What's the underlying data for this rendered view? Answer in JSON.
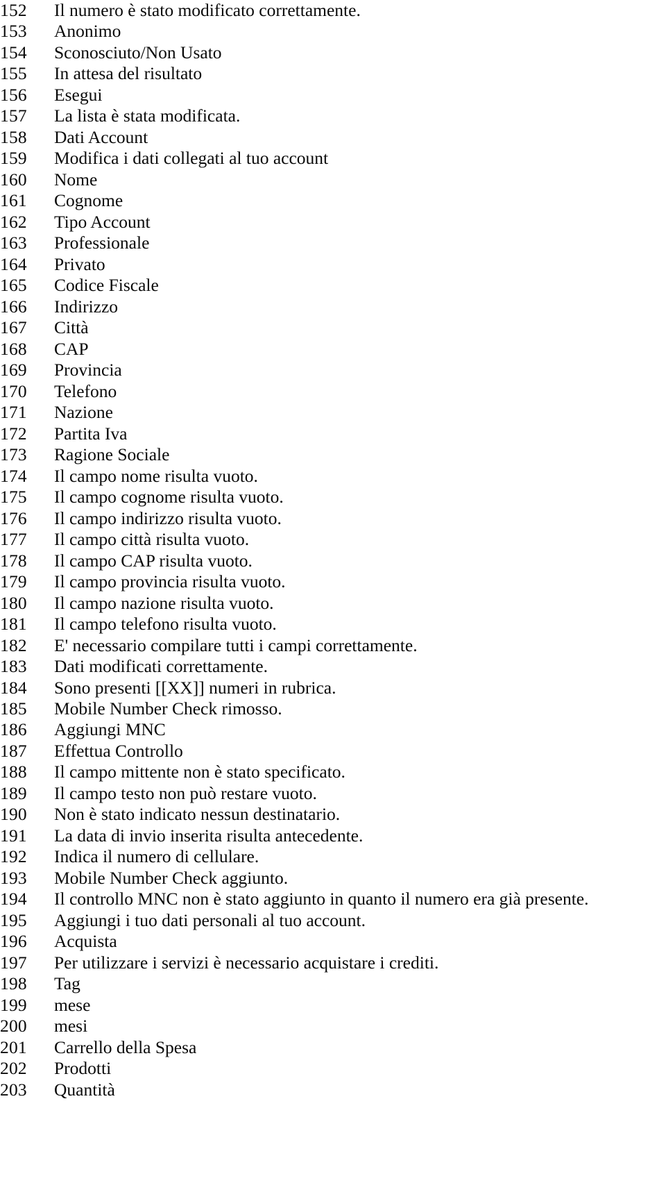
{
  "document": {
    "type": "numbered-string-list",
    "language": "Italian",
    "first_line_number": 152,
    "last_line_number": 203,
    "total_rows": 52,
    "text_color": "#0a0a0a",
    "background_color": "#ffffff"
  },
  "rows": [
    {
      "number": "152",
      "text": "Il numero è stato modificato correttamente."
    },
    {
      "number": "153",
      "text": "Anonimo"
    },
    {
      "number": "154",
      "text": "Sconosciuto/Non Usato"
    },
    {
      "number": "155",
      "text": "In attesa del risultato"
    },
    {
      "number": "156",
      "text": "Esegui"
    },
    {
      "number": "157",
      "text": "La lista è stata modificata."
    },
    {
      "number": "158",
      "text": "Dati Account"
    },
    {
      "number": "159",
      "text": "Modifica i dati collegati al tuo account"
    },
    {
      "number": "160",
      "text": "Nome"
    },
    {
      "number": "161",
      "text": "Cognome"
    },
    {
      "number": "162",
      "text": "Tipo Account"
    },
    {
      "number": "163",
      "text": "Professionale"
    },
    {
      "number": "164",
      "text": "Privato"
    },
    {
      "number": "165",
      "text": "Codice Fiscale"
    },
    {
      "number": "166",
      "text": "Indirizzo"
    },
    {
      "number": "167",
      "text": "Città"
    },
    {
      "number": "168",
      "text": "CAP"
    },
    {
      "number": "169",
      "text": "Provincia"
    },
    {
      "number": "170",
      "text": "Telefono"
    },
    {
      "number": "171",
      "text": "Nazione"
    },
    {
      "number": "172",
      "text": "Partita Iva"
    },
    {
      "number": "173",
      "text": "Ragione Sociale"
    },
    {
      "number": "174",
      "text": "Il campo nome risulta vuoto."
    },
    {
      "number": "175",
      "text": "Il campo cognome risulta vuoto."
    },
    {
      "number": "176",
      "text": "Il campo indirizzo risulta vuoto."
    },
    {
      "number": "177",
      "text": "Il campo città risulta vuoto."
    },
    {
      "number": "178",
      "text": "Il campo CAP risulta vuoto."
    },
    {
      "number": "179",
      "text": "Il campo provincia risulta vuoto."
    },
    {
      "number": "180",
      "text": "Il campo nazione risulta vuoto."
    },
    {
      "number": "181",
      "text": "Il campo telefono risulta vuoto."
    },
    {
      "number": "182",
      "text": "E' necessario compilare tutti i campi correttamente."
    },
    {
      "number": "183",
      "text": "Dati modificati correttamente."
    },
    {
      "number": "184",
      "text": "Sono presenti [[XX]] numeri in rubrica."
    },
    {
      "number": "185",
      "text": "Mobile Number Check rimosso."
    },
    {
      "number": "186",
      "text": "Aggiungi MNC"
    },
    {
      "number": "187",
      "text": "Effettua Controllo"
    },
    {
      "number": "188",
      "text": "Il campo mittente non è stato specificato."
    },
    {
      "number": "189",
      "text": "Il campo testo non può restare vuoto."
    },
    {
      "number": "190",
      "text": "Non è stato indicato nessun destinatario."
    },
    {
      "number": "191",
      "text": "La data di invio inserita risulta antecedente."
    },
    {
      "number": "192",
      "text": "Indica il numero di cellulare."
    },
    {
      "number": "193",
      "text": "Mobile Number Check aggiunto."
    },
    {
      "number": "194",
      "text": "Il controllo MNC non è stato aggiunto in quanto il numero era già presente."
    },
    {
      "number": "195",
      "text": "Aggiungi i tuo dati personali al tuo account."
    },
    {
      "number": "196",
      "text": "Acquista"
    },
    {
      "number": "197",
      "text": "Per utilizzare i servizi è necessario acquistare i crediti."
    },
    {
      "number": "198",
      "text": "Tag"
    },
    {
      "number": "199",
      "text": "mese"
    },
    {
      "number": "200",
      "text": "mesi"
    },
    {
      "number": "201",
      "text": "Carrello della Spesa"
    },
    {
      "number": "202",
      "text": "Prodotti"
    },
    {
      "number": "203",
      "text": "Quantità"
    }
  ]
}
